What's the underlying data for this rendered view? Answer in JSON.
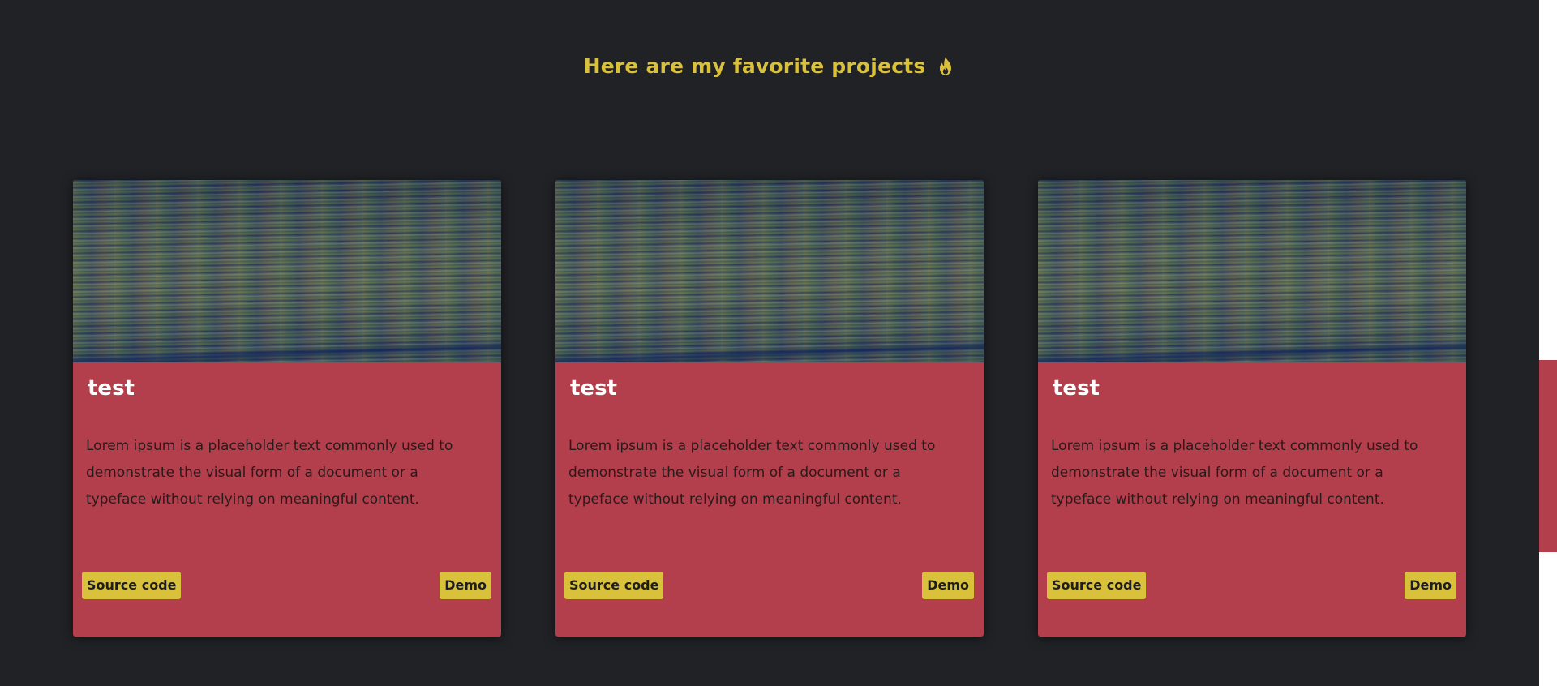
{
  "section": {
    "title": "Here are my favorite projects",
    "title_icon": "flame-icon"
  },
  "colors": {
    "background": "#212226",
    "accent_yellow": "#d9c13b",
    "card_red": "#b33f4c",
    "title_white": "#ffffff"
  },
  "projects": [
    {
      "title": "test",
      "description": "Lorem ipsum is a placeholder text commonly used to demonstrate the visual form of a document or a typeface without relying on meaningful content.",
      "source_label": "Source code",
      "demo_label": "Demo"
    },
    {
      "title": "test",
      "description": "Lorem ipsum is a placeholder text commonly used to demonstrate the visual form of a document or a typeface without relying on meaningful content.",
      "source_label": "Source code",
      "demo_label": "Demo"
    },
    {
      "title": "test",
      "description": "Lorem ipsum is a placeholder text commonly used to demonstrate the visual form of a document or a typeface without relying on meaningful content.",
      "source_label": "Source code",
      "demo_label": "Demo"
    }
  ]
}
